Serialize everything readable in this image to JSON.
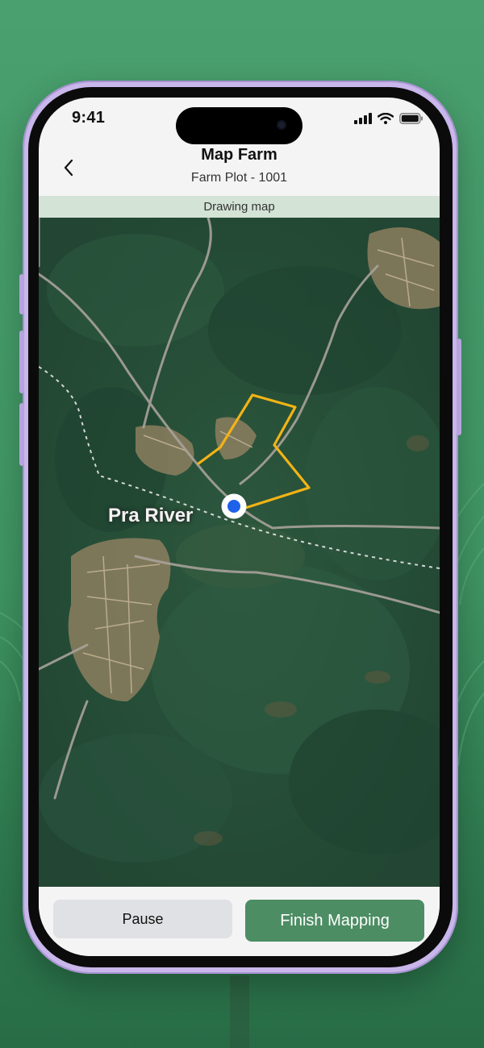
{
  "status_bar": {
    "time": "9:41"
  },
  "header": {
    "title": "Map Farm",
    "subtitle": "Farm Plot - 1001",
    "back_icon": "chevron-left-icon"
  },
  "banner": {
    "text": "Drawing map"
  },
  "map": {
    "place_label": "Pra River",
    "map_type": "satellite",
    "boundary_color": "#f2b316",
    "location_color": "#1e62ea"
  },
  "actions": {
    "pause_label": "Pause",
    "finish_label": "Finish Mapping"
  },
  "colors": {
    "accent": "#4c8d63",
    "background": "#439a68"
  }
}
